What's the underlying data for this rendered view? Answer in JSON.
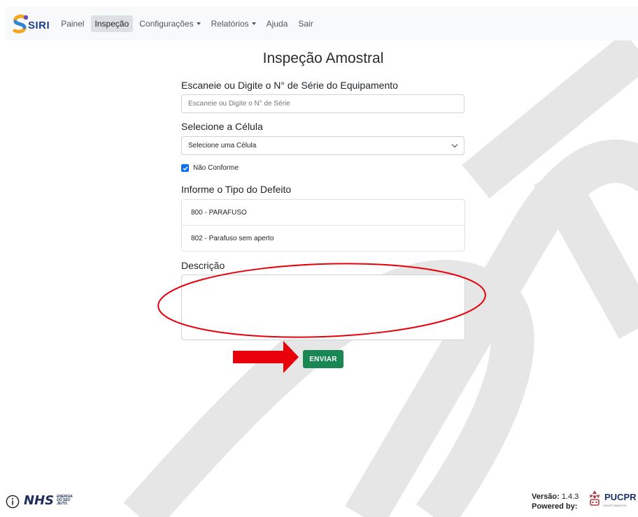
{
  "navbar": {
    "brand": "SIRI",
    "items": [
      {
        "label": "Painel",
        "active": false,
        "dropdown": false
      },
      {
        "label": "Inspeção",
        "active": true,
        "dropdown": false
      },
      {
        "label": "Configurações",
        "active": false,
        "dropdown": true
      },
      {
        "label": "Relatórios",
        "active": false,
        "dropdown": true
      },
      {
        "label": "Ajuda",
        "active": false,
        "dropdown": false
      },
      {
        "label": "Sair",
        "active": false,
        "dropdown": false
      }
    ]
  },
  "form": {
    "title": "Inspeção Amostral",
    "serial_label": "Escaneie ou Digite o N° de Série do Equipamento",
    "serial_placeholder": "Escaneie ou Digite o N° de Série",
    "serial_value": "",
    "cell_label": "Selecione a Célula",
    "cell_selected": "Selecione uma Célula",
    "nonconform_label": "Não Conforme",
    "nonconform_checked": true,
    "defect_label": "Informe o Tipo do Defeito",
    "defects": [
      "800 - PARAFUSO",
      "802 - Parafuso sem aperto"
    ],
    "description_label": "Descrição",
    "description_value": "",
    "submit_label": "ENVIAR"
  },
  "footer": {
    "nhs_logo": "NHS",
    "nhs_tagline": [
      "ENERGIA",
      "DO SEU",
      "JEITO."
    ],
    "version_label": "Versão:",
    "version_value": "1.4.3",
    "powered_label": "Powered by:",
    "partner_logo": "PUCPR",
    "partner_sub": "GRUPO MARISTA"
  },
  "colors": {
    "primary": "#0d6efd",
    "success": "#198754",
    "annotation": "#e8000b",
    "navbar_bg": "#f8f9fa",
    "watermark": "#e6e6e6"
  }
}
